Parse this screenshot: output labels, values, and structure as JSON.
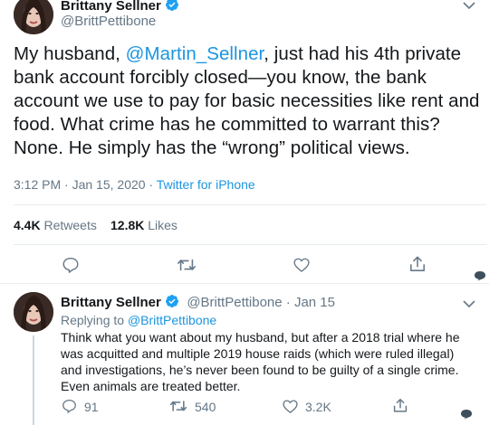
{
  "main_tweet": {
    "author_name": "Brittany Sellner",
    "author_handle": "@BrittPettibone",
    "text_before_mention": "My husband, ",
    "mention": "@Martin_Sellner",
    "text_after_mention": ", just had his 4th private bank account forcibly closed—you know, the bank account we use to pay for basic necessities like rent and food. What crime has he committed to warrant this? None. He simply has the “wrong” political views.",
    "time": "3:12 PM",
    "separator": " · ",
    "date": "Jan 15, 2020",
    "source": "Twitter for iPhone",
    "retweets_count": "4.4K",
    "retweets_label": "Retweets",
    "likes_count": "12.8K",
    "likes_label": "Likes"
  },
  "reply_tweet": {
    "author_name": "Brittany Sellner",
    "author_handle": "@BrittPettibone",
    "separator": " · ",
    "date": "Jan 15",
    "replying_prefix": "Replying to ",
    "replying_to": "@BrittPettibone",
    "text": "Think what you want about my husband, but after a 2018 trial where he was acquitted and multiple 2019 house raids (which were ruled illegal) and investigations, he’s never been found to be guilty of a single crime. Even animals are treated better.",
    "reply_count": "91",
    "retweet_count": "540",
    "like_count": "3.2K"
  },
  "colors": {
    "accent": "#1b95e0",
    "verified": "#1da1f2",
    "muted": "#657786",
    "divider": "#e6ecf0"
  },
  "icons": {
    "verified": "verified-badge-icon",
    "chevron": "chevron-down-icon",
    "reply": "reply-icon",
    "retweet": "retweet-icon",
    "like": "heart-icon",
    "share": "share-icon",
    "chat": "chat-bubble-icon"
  }
}
